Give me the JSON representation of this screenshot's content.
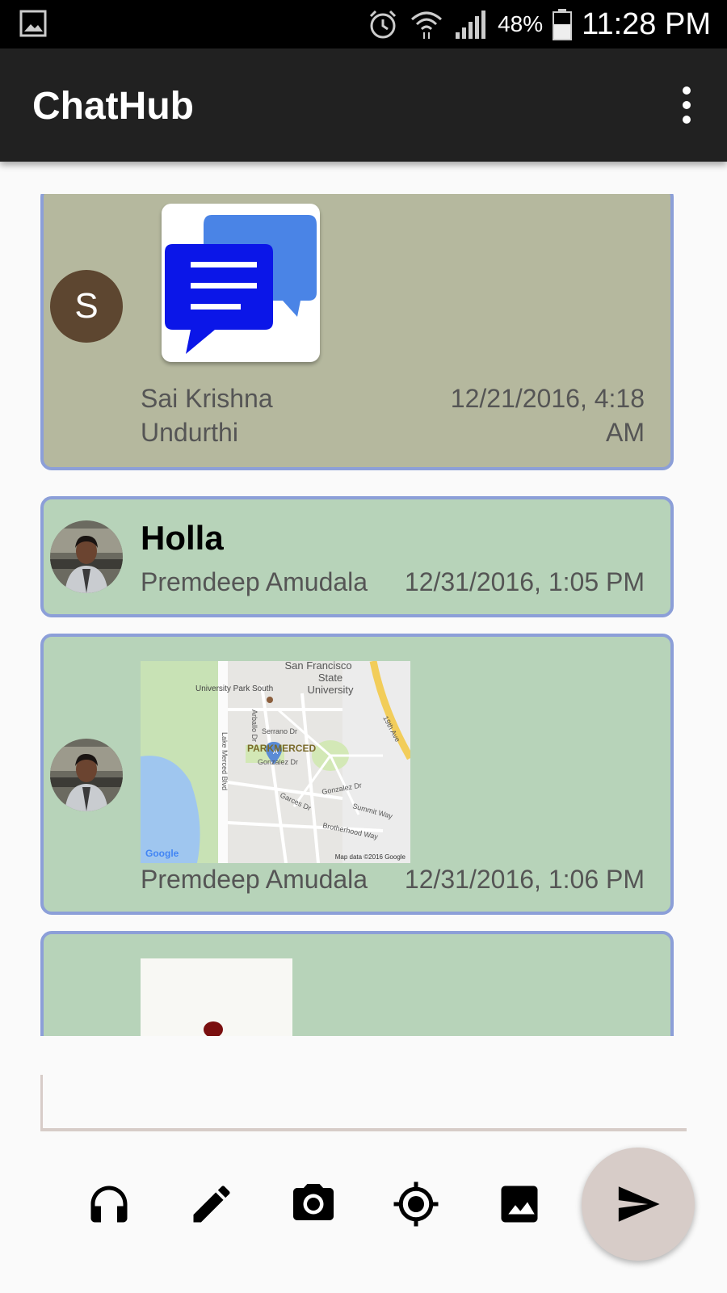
{
  "status_bar": {
    "battery_percent": "48%",
    "time": "11:28 PM",
    "icons": [
      "gallery-icon",
      "alarm-icon",
      "wifi-icon",
      "signal-icon",
      "battery-icon"
    ]
  },
  "app_bar": {
    "title": "ChatHub",
    "menu_icon": "more-vert-icon"
  },
  "messages": [
    {
      "type": "image",
      "avatar_letter": "S",
      "sender_line1": "Sai Krishna",
      "sender_line2": "Undurthi",
      "time_line1": "12/21/2016, 4:18",
      "time_line2": "AM",
      "card_color": "#b5b89e"
    },
    {
      "type": "text",
      "text": "Holla",
      "sender": "Premdeep Amudala",
      "time": "12/31/2016, 1:05 PM",
      "card_color": "#b7d3b9"
    },
    {
      "type": "map",
      "sender": "Premdeep Amudala",
      "time": "12/31/2016, 1:06 PM",
      "map_labels": {
        "sfsu_line1": "San Francisco",
        "sfsu_line2": "State",
        "sfsu_line3": "University",
        "university_park": "University Park South",
        "parkmerced": "PARKMERCED",
        "arballo": "Arballo Dr",
        "serrano": "Serrano Dr",
        "gonzalez": "Gonzalez Dr",
        "gonzalez2": "Gonzalez Dr",
        "lake_merced": "Lake Merced Blvd",
        "garces": "Garces Dr",
        "summit": "Summit Way",
        "brotherhood": "Brotherhood Way",
        "ave19": "19th Ave",
        "google": "Google",
        "map_data": "Map data ©2016 Google"
      },
      "card_color": "#b7d3b9"
    },
    {
      "type": "image",
      "card_color": "#b7d3b9"
    }
  ],
  "composer": {
    "value": "",
    "placeholder": ""
  },
  "toolbar": {
    "tools": [
      "headset-icon",
      "pencil-icon",
      "camera-icon",
      "location-icon",
      "image-icon"
    ],
    "send_icon": "send-icon"
  },
  "colors": {
    "app_bar": "#212121",
    "card_border": "#8c9fd8",
    "fab": "#d7ccc8"
  }
}
